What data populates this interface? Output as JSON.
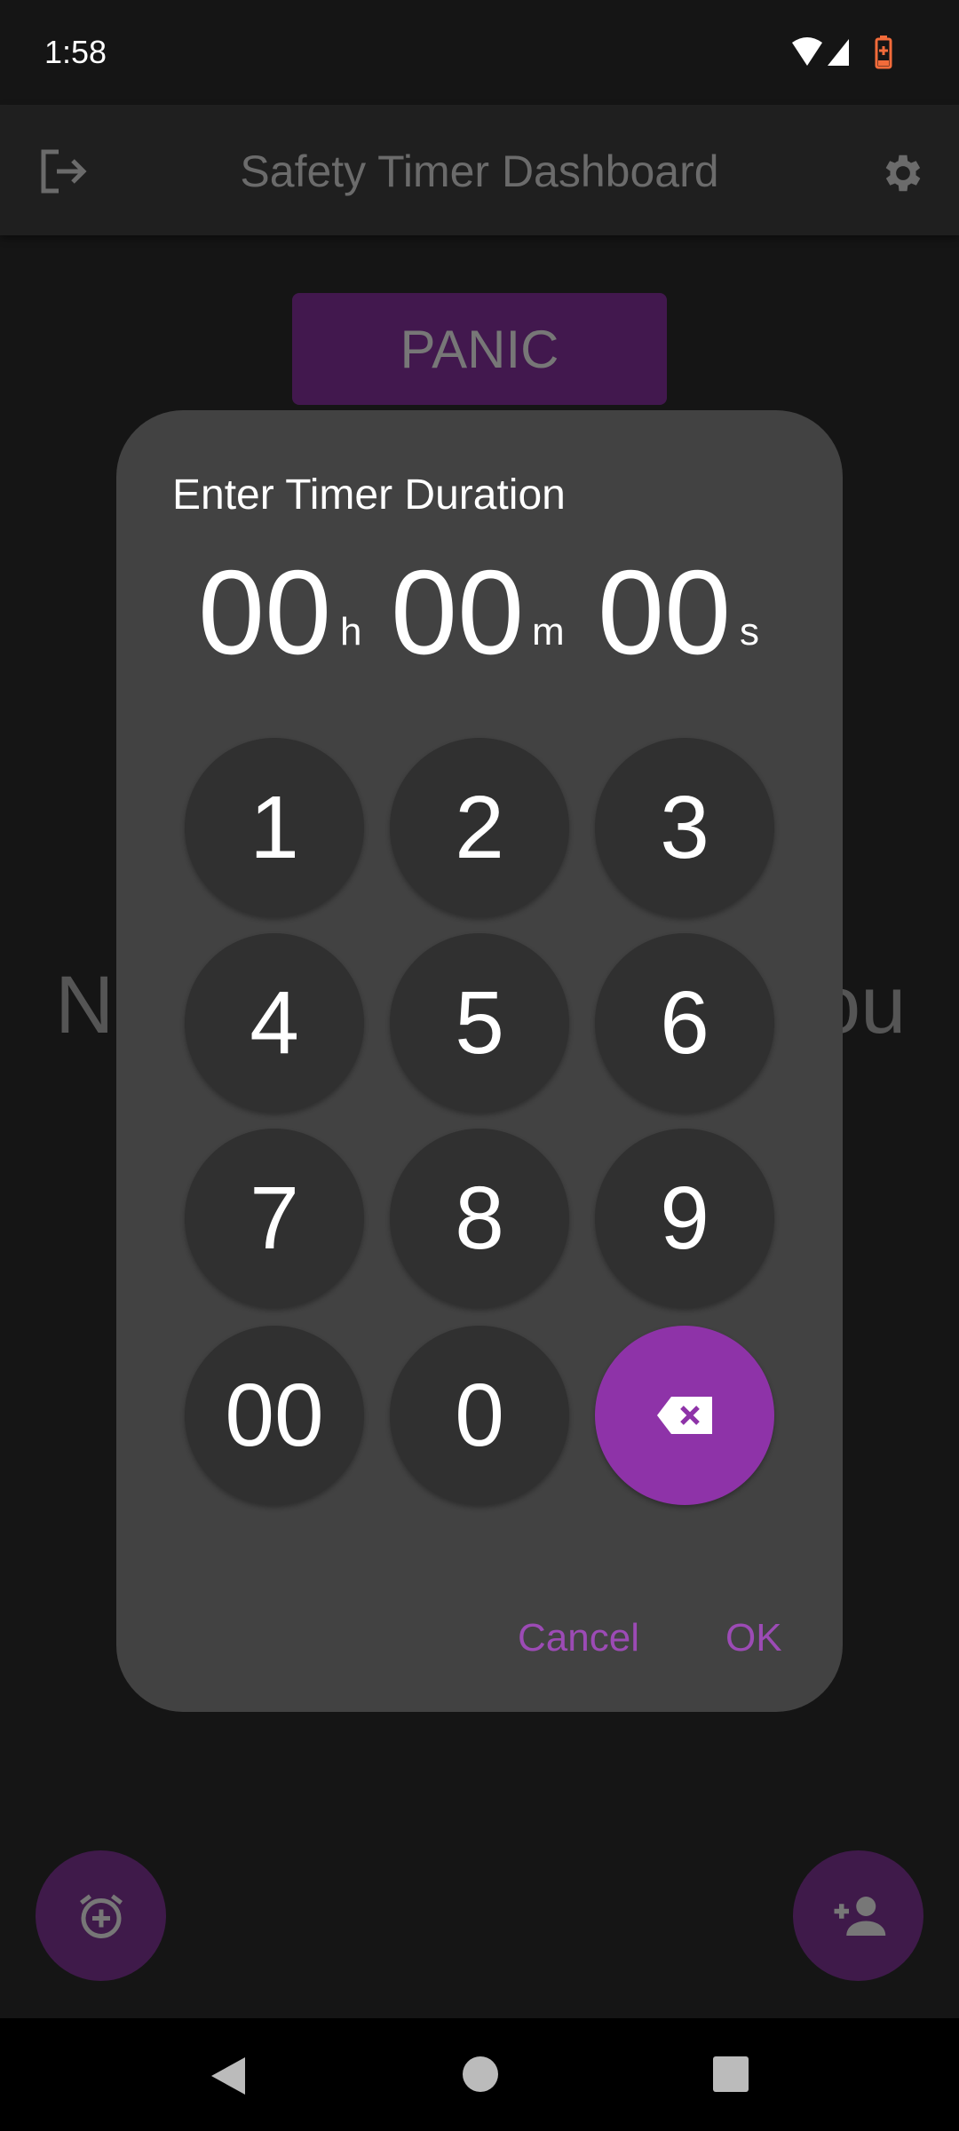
{
  "status_bar": {
    "time": "1:58",
    "icons": [
      "wifi-icon",
      "signal-icon",
      "battery-charging-icon"
    ],
    "battery_color": "#f26b3a"
  },
  "app_bar": {
    "title": "Safety Timer Dashboard",
    "left_icon": "logout-icon",
    "right_icon": "gear-icon"
  },
  "main": {
    "panic_label": "PANIC",
    "background_text_left": "N",
    "background_text_right": "ou"
  },
  "dialog": {
    "title": "Enter Timer Duration",
    "hours": "00",
    "hours_unit": "h",
    "minutes": "00",
    "minutes_unit": "m",
    "seconds": "00",
    "seconds_unit": "s",
    "keys": [
      "1",
      "2",
      "3",
      "4",
      "5",
      "6",
      "7",
      "8",
      "9",
      "00",
      "0"
    ],
    "backspace_icon": "backspace-icon",
    "cancel_label": "Cancel",
    "ok_label": "OK",
    "accent": "#8e33a8"
  },
  "fabs": {
    "left_icon": "add-alarm-icon",
    "right_icon": "add-person-icon"
  },
  "nav": {
    "icons": [
      "back-icon",
      "home-icon",
      "recents-icon"
    ]
  }
}
